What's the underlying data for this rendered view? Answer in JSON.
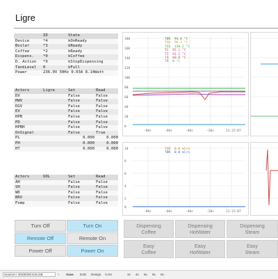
{
  "app": {
    "title": "Ligre"
  },
  "status_table": {
    "headers": [
      "",
      "ID",
      "State"
    ],
    "rows": [
      [
        "Device",
        "*4",
        "kOnReady"
      ],
      [
        "Boiler",
        "*3",
        "kReady"
      ],
      [
        "Coffee",
        "*2",
        "kReady"
      ],
      [
        "Dispens.",
        "*0",
        "kCoffee"
      ],
      [
        "D. Action",
        "*9",
        "kStopDispensing"
      ],
      [
        "TankLevel",
        "0",
        "kFull"
      ]
    ],
    "power_label": "Power",
    "power_value": "236.0V 50Hz 0.03A 8.14Watt"
  },
  "actors_table": {
    "headers": [
      "Actors",
      "Ligre",
      "Set",
      "Read"
    ],
    "rows": [
      [
        "DV",
        "",
        "False",
        "False"
      ],
      [
        "HWV",
        "",
        "False",
        "False"
      ],
      [
        "DGV",
        "",
        "False",
        "False"
      ],
      [
        "EV",
        "",
        "False",
        "False"
      ],
      [
        "HPB",
        "",
        "False",
        "False"
      ],
      [
        "PD",
        "",
        "False",
        "False"
      ],
      [
        "HPBH",
        "",
        "False",
        "False"
      ],
      [
        "OnSignal",
        "",
        "False",
        "True"
      ],
      [
        "PL",
        "",
        "0.000",
        "0.000"
      ],
      [
        "PH",
        "",
        "0.000",
        "0.000"
      ],
      [
        "HT",
        "",
        "0.000",
        "0.000"
      ]
    ]
  },
  "actors_table2": {
    "headers": [
      "Actors",
      "UOL",
      "Set",
      "Read"
    ],
    "rows": [
      [
        "AH",
        "",
        "False",
        "False"
      ],
      [
        "SH",
        "",
        "False",
        "False"
      ],
      [
        "WD",
        "",
        "False",
        "False"
      ],
      [
        "BRV",
        "",
        "False",
        "False"
      ],
      [
        "Pump",
        "",
        "False",
        "False"
      ]
    ]
  },
  "chart_top": {
    "ylabels": [
      "180",
      "160",
      "140",
      "120",
      "100",
      "80",
      "60",
      "40",
      "20",
      "0"
    ],
    "xlabels": [
      "-80s",
      "-60s",
      "-40s",
      "-20s"
    ],
    "time": "11:22:07",
    "legend": [
      {
        "name": "TBR",
        "value": "94.0 °C",
        "color": "#3a8a3a"
      },
      {
        "name": "TSH",
        "value": "96.2 °C",
        "color": "#c79a2a"
      },
      {
        "name": "TSS",
        "value": "138.2 °C",
        "color": "#3ab05a"
      },
      {
        "name": "TC",
        "value": "92.1 °C",
        "color": "#d04a4a"
      },
      {
        "name": "TI",
        "value": "91.1 °C",
        "color": "#9a4ac0"
      },
      {
        "name": "T4",
        "value": "60.0 °C",
        "color": "#d05030"
      },
      {
        "name": "TB",
        "value": "0 °C",
        "color": "#3a9ad0"
      }
    ]
  },
  "chart_bottom": {
    "ylabels": [
      "10",
      "8",
      "6",
      "4",
      "2",
      "0"
    ],
    "xlabels": [
      "-80s",
      "-60s",
      "-40s",
      "-20s"
    ],
    "time": "11:22:07",
    "legend": [
      {
        "name": "TSR",
        "value": "0.0 ml/s",
        "color": "#c07a20"
      },
      {
        "name": "TBR",
        "value": "0.0 ml/s",
        "color": "#2a6ad0"
      }
    ]
  },
  "buttons": {
    "turn_off": "Turn Off",
    "turn_on": "Turn On",
    "remote_off": "Remote Off",
    "remote_on": "Remote On",
    "power_off": "Power Off",
    "power_on": "Power On"
  },
  "dispense": {
    "coffee": [
      "Dispensing",
      "Coffee"
    ],
    "hotwater": [
      "Dispensing",
      "HotWater"
    ],
    "steam": [
      "Dispensing",
      "Steam"
    ],
    "easy_coffee": [
      "Easy",
      "Coffee"
    ],
    "easy_hotwater": [
      "Easy",
      "HotWater"
    ],
    "easy_steam": [
      "Easy",
      "Steam"
    ]
  },
  "bottombar": {
    "left": "ScanVA / 2028/008 ESLGB",
    "save": "Save",
    "esd": "ESD",
    "design": "Design",
    "can": "CAN",
    "opts": [
      "3x",
      "4x",
      "8x",
      "8x",
      "8x"
    ]
  },
  "colors": {
    "accent_button": "#bfe6f7",
    "background": "#ffffff"
  }
}
